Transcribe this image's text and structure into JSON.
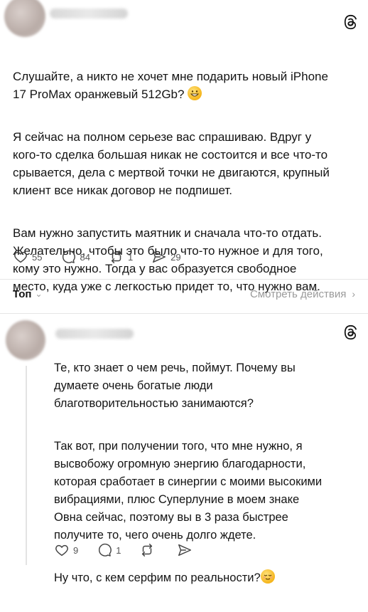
{
  "post": {
    "paragraphs": [
      "Слушайте, а никто не хочет мне подарить новый iPhone\n17 ProMax оранжевый 512Gb?",
      "Я сейчас на полном серьезе вас спрашиваю. Вдруг у\nкого-то сделка большая никак не состоится и все что-то\nсрывается, дела с мертвой точки не двигаются, крупный\nклиент все никак договор не подпишет.",
      "Вам нужно запустить маятник и сначала что-то отдать.\nЖелательно, чтобы это было что-то нужное и для того,\nкому это нужно. Тогда у вас образуется свободное\nместо, куда уже с легкостью придет то, что нужно вам."
    ],
    "likes": "55",
    "comments": "84",
    "reposts": "1",
    "shares": "29"
  },
  "sortbar": {
    "label": "Топ",
    "view_actions": "Смотреть действия"
  },
  "reply": {
    "paragraphs": [
      "Те, кто знает о чем речь, поймут. Почему вы\nдумаете очень богатые люди\nблаготворительностью занимаются?",
      "Так вот, при получении того, что мне нужно, я\nвысвобожу огромную энергию благодарности,\nкоторая сработает в синергии с моими высокими\nвибрациями, плюс Суперлуние в моем знаке\nОвна сейчас, поэтому вы в 3 раза быстрее\nполучите то, чего очень долго ждете.",
      "Ну что, с кем серфим по реальности?"
    ],
    "likes": "9",
    "comments": "1"
  },
  "icons": {
    "threads": "threads-logo-icon",
    "like": "heart-icon",
    "comment": "comment-bubble-icon",
    "repost": "repost-icon",
    "share": "send-icon",
    "emoji_grin": "grinning-face-emoji",
    "emoji_relieved": "relieved-face-emoji"
  },
  "colors": {
    "text": "#141414",
    "muted": "#9a9a9a",
    "divider": "#e6e6e6"
  }
}
